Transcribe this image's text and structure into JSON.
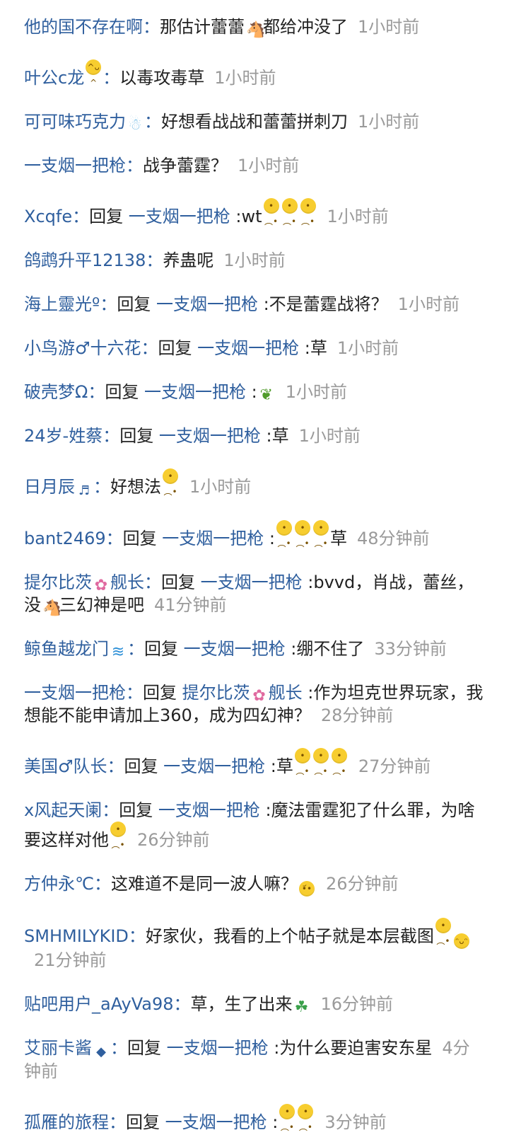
{
  "comments": [
    {
      "user": "他的国不存在啊",
      "sep": "：",
      "reply_prefix": "",
      "target": "",
      "target_sep": "",
      "text": "那估计蕾蕾",
      "emoji": "horse-icon",
      "emoji2": "",
      "emoji3": "",
      "text2": "都给冲没了",
      "time": "1小时前"
    },
    {
      "user": "叶公c龙",
      "user_emoji": "grin-face-icon",
      "sep": "：",
      "reply_prefix": "",
      "target": "",
      "target_sep": "",
      "text": "以毒攻毒草",
      "emoji": "",
      "emoji2": "",
      "emoji3": "",
      "text2": "",
      "time": "1小时前"
    },
    {
      "user": "可可味巧克力",
      "user_emoji": "snowman-icon",
      "sep": "：",
      "reply_prefix": "",
      "target": "",
      "target_sep": "",
      "text": "好想看战战和蕾蕾拼刺刀",
      "emoji": "",
      "emoji2": "",
      "emoji3": "",
      "text2": "",
      "time": "1小时前"
    },
    {
      "user": "一支烟一把枪",
      "sep": "：",
      "reply_prefix": "",
      "target": "",
      "target_sep": "",
      "text": "战争蕾霆？",
      "emoji": "",
      "emoji2": "",
      "emoji3": "",
      "text2": "",
      "time": "1小时前"
    },
    {
      "user": "Xcqfe",
      "sep": "：",
      "reply_prefix": "回复 ",
      "target": "一支烟一把枪",
      "target_sep": " :",
      "text": "wt",
      "emoji": "sneeze-face-icon",
      "emoji2": "sneeze-face-icon",
      "emoji3": "sneeze-face-icon",
      "text2": "",
      "time": "1小时前"
    },
    {
      "user": "鸽鹉升平12138",
      "sep": "：",
      "reply_prefix": "",
      "target": "",
      "target_sep": "",
      "text": "养蛊呢",
      "emoji": "",
      "emoji2": "",
      "emoji3": "",
      "text2": "",
      "time": "1小时前"
    },
    {
      "user": "海上靈光º",
      "sep": "：",
      "reply_prefix": "回复 ",
      "target": "一支烟一把枪",
      "target_sep": " :",
      "text": "不是蕾霆战将？",
      "emoji": "",
      "emoji2": "",
      "emoji3": "",
      "text2": "",
      "time": "1小时前"
    },
    {
      "user": "小鸟游♂十六花",
      "sep": "：",
      "reply_prefix": "回复 ",
      "target": "一支烟一把枪",
      "target_sep": " :",
      "text": "草",
      "emoji": "",
      "emoji2": "",
      "emoji3": "",
      "text2": "",
      "time": "1小时前"
    },
    {
      "user": "破壳梦Ω",
      "sep": "：",
      "reply_prefix": "回复 ",
      "target": "一支烟一把枪",
      "target_sep": " :",
      "text": "",
      "emoji": "leaf-icon",
      "emoji2": "",
      "emoji3": "",
      "text2": "",
      "time": "1小时前"
    },
    {
      "user": "24岁-姓蔡",
      "sep": "：",
      "reply_prefix": "回复 ",
      "target": "一支烟一把枪",
      "target_sep": " :",
      "text": "草",
      "emoji": "",
      "emoji2": "",
      "emoji3": "",
      "text2": "",
      "time": "1小时前"
    },
    {
      "user": "日月辰",
      "user_emoji": "music-note-icon",
      "sep": "：",
      "reply_prefix": "",
      "target": "",
      "target_sep": "",
      "text": "好想法",
      "emoji": "sneeze-face-icon",
      "emoji2": "",
      "emoji3": "",
      "text2": "",
      "time": "1小时前"
    },
    {
      "user": "bant2469",
      "sep": "：",
      "reply_prefix": "回复 ",
      "target": "一支烟一把枪",
      "target_sep": " :",
      "text": "",
      "emoji": "sneeze-face-icon",
      "emoji2": "sneeze-face-icon",
      "emoji3": "sneeze-face-icon",
      "text2": "草",
      "time": "48分钟前"
    },
    {
      "user": "提尔比茨",
      "user_emoji": "flower-icon",
      "user2": "舰长",
      "sep": "：",
      "reply_prefix": "回复 ",
      "target": "一支烟一把枪",
      "target_sep": " :",
      "text": "bvvd，肖战，蕾丝，没",
      "emoji": "horse-icon",
      "emoji2": "",
      "emoji3": "",
      "text2": "三幻神是吧",
      "time": "41分钟前"
    },
    {
      "user": "鲸鱼越龙门",
      "user_emoji": "wave-icon",
      "sep": "：",
      "reply_prefix": "回复 ",
      "target": "一支烟一把枪",
      "target_sep": " :",
      "text": "绷不住了",
      "emoji": "",
      "emoji2": "",
      "emoji3": "",
      "text2": "",
      "time": "33分钟前"
    },
    {
      "user": "一支烟一把枪",
      "sep": "：",
      "reply_prefix": "回复 ",
      "target": "提尔比茨",
      "target_emoji": "flower-icon",
      "target2": "舰长",
      "target_sep": " :",
      "text": "作为坦克世界玩家，我想能不能申请加上360，成为四幻神？",
      "emoji": "",
      "emoji2": "",
      "emoji3": "",
      "text2": "",
      "time": "28分钟前"
    },
    {
      "user": "美国♂队长",
      "sep": "：",
      "reply_prefix": "回复 ",
      "target": "一支烟一把枪",
      "target_sep": " :",
      "text": "草",
      "emoji": "sneeze-face-icon",
      "emoji2": "sneeze-face-icon",
      "emoji3": "sneeze-face-icon",
      "text2": "",
      "time": "27分钟前"
    },
    {
      "user": "x风起天阑",
      "sep": "：",
      "reply_prefix": "回复 ",
      "target": "一支烟一把枪",
      "target_sep": " :",
      "text": "魔法雷霆犯了什么罪，为啥要这样对他",
      "emoji": "sneeze-face-icon",
      "emoji2": "",
      "emoji3": "",
      "text2": "",
      "time": "26分钟前"
    },
    {
      "user": "方仲永℃",
      "sep": "：",
      "reply_prefix": "",
      "target": "",
      "target_sep": "",
      "text": "这难道不是同一波人嘛？",
      "emoji": "confused-face-icon",
      "emoji2": "",
      "emoji3": "",
      "text2": "",
      "time": "26分钟前"
    },
    {
      "user": "SMHMILYKID",
      "sep": "：",
      "reply_prefix": "",
      "target": "",
      "target_sep": "",
      "text": "好家伙，我看的上个帖子就是本层截图",
      "emoji": "sneeze-face-icon",
      "emoji2": "smile-face-icon",
      "emoji3": "",
      "text2": "",
      "time": "21分钟前"
    },
    {
      "user": "贴吧用户_aAyVa98",
      "sep": "：",
      "reply_prefix": "",
      "target": "",
      "target_sep": "",
      "text": "草，生了出来",
      "emoji": "clover-icon",
      "emoji2": "",
      "emoji3": "",
      "text2": "",
      "time": "16分钟前"
    },
    {
      "user": "艾丽卡酱",
      "user_emoji": "diamond-icon",
      "sep": "：",
      "reply_prefix": "回复 ",
      "target": "一支烟一把枪",
      "target_sep": " :",
      "text": "为什么要迫害安东星",
      "emoji": "",
      "emoji2": "",
      "emoji3": "",
      "text2": "",
      "time": "4分钟前"
    },
    {
      "user": "孤雁的旅程",
      "sep": "：",
      "reply_prefix": "回复 ",
      "target": "一支烟一把枪",
      "target_sep": " :",
      "text": "",
      "emoji": "sneeze-face-icon",
      "emoji2": "sneeze-face-icon",
      "emoji3": "",
      "text2": "",
      "time": "3分钟前"
    }
  ],
  "colors": {
    "username": "#2f5f9e",
    "text": "#222222",
    "time": "#9a9a9a"
  }
}
